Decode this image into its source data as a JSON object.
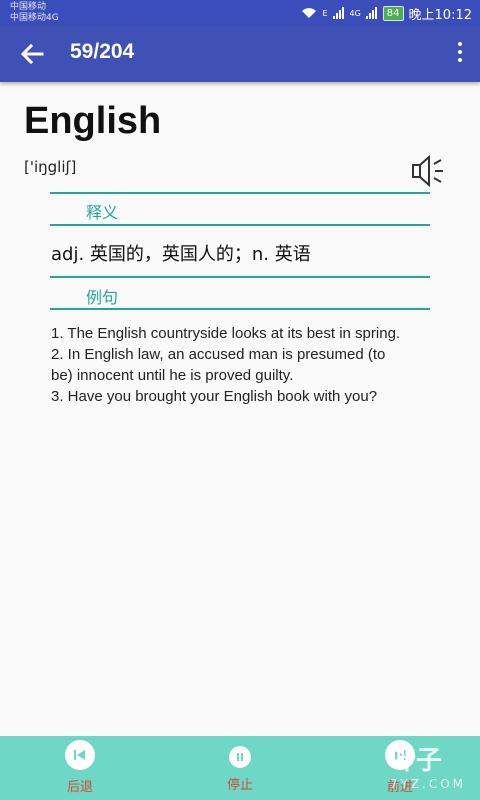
{
  "status_bar": {
    "carrier1": "中国移动",
    "carrier2": "中国移动4G",
    "sig1": "E",
    "sig2": "4G",
    "battery": "84",
    "time": "晚上10:12"
  },
  "toolbar": {
    "counter": "59/204"
  },
  "word": {
    "term": "English",
    "phonetic": "['iŋgliʃ]",
    "definition_header": "释义",
    "definition": "adj. 英国的，英国人的；n. 英语",
    "examples_header": "例句",
    "examples": [
      "1. The English countryside looks at its best in spring.",
      "2. In English law, an accused man is presumed (to be) innocent until he is proved guilty.",
      "3. Have you brought your English book with you?"
    ]
  },
  "bottom_nav": {
    "prev": "后退",
    "stop": "停止",
    "next": "前进"
  },
  "watermark": {
    "brand": "叶子",
    "site": "7YZ.COM"
  },
  "colors": {
    "primary": "#3f51b5",
    "accent": "#26a69a",
    "bottom_bar": "#6fd7c6",
    "nav_label": "#d24c3a"
  }
}
